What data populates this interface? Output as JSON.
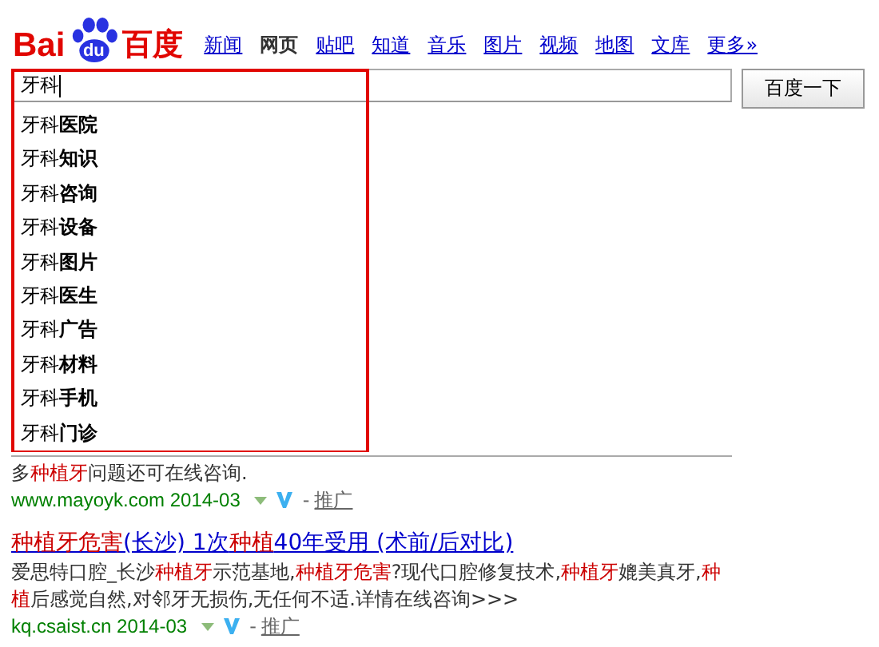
{
  "logo": {
    "left": "Bai",
    "mark": "du",
    "right": "百度"
  },
  "nav": [
    {
      "label": "新闻",
      "selected": false
    },
    {
      "label": "网页",
      "selected": true
    },
    {
      "label": "贴吧",
      "selected": false
    },
    {
      "label": "知道",
      "selected": false
    },
    {
      "label": "音乐",
      "selected": false
    },
    {
      "label": "图片",
      "selected": false
    },
    {
      "label": "视频",
      "selected": false
    },
    {
      "label": "地图",
      "selected": false
    },
    {
      "label": "文库",
      "selected": false
    },
    {
      "label": "更多»",
      "selected": false
    }
  ],
  "search": {
    "value": "牙科",
    "button": "百度一下"
  },
  "suggestions": [
    {
      "prefix": "牙科",
      "rest": "医院"
    },
    {
      "prefix": "牙科",
      "rest": "知识"
    },
    {
      "prefix": "牙科",
      "rest": "咨询"
    },
    {
      "prefix": "牙科",
      "rest": "设备"
    },
    {
      "prefix": "牙科",
      "rest": "图片"
    },
    {
      "prefix": "牙科",
      "rest": "医生"
    },
    {
      "prefix": "牙科",
      "rest": "广告"
    },
    {
      "prefix": "牙科",
      "rest": "材料"
    },
    {
      "prefix": "牙科",
      "rest": "手机"
    },
    {
      "prefix": "牙科",
      "rest": "门诊"
    }
  ],
  "results": [
    {
      "snippet": [
        {
          "text": "多",
          "highlight": false
        },
        {
          "text": "种植牙",
          "highlight": true
        },
        {
          "text": "问题还可在线咨询.",
          "highlight": false
        }
      ],
      "url": "www.mayoyk.com",
      "date": "2014-03",
      "separator": "-",
      "promo": "推广"
    },
    {
      "title": [
        {
          "text": "种植牙危害",
          "highlight": true
        },
        {
          "text": "(长沙)  1次",
          "highlight": false
        },
        {
          "text": "种植",
          "highlight": true
        },
        {
          "text": "40年受用  (术前/后对比)",
          "highlight": false
        }
      ],
      "snippet": [
        {
          "text": "爱思特口腔_长沙",
          "highlight": false
        },
        {
          "text": "种植牙",
          "highlight": true
        },
        {
          "text": "示范基地,",
          "highlight": false
        },
        {
          "text": "种植牙危害",
          "highlight": true
        },
        {
          "text": "?现代口腔修复技术,",
          "highlight": false
        },
        {
          "text": "种植牙",
          "highlight": true
        },
        {
          "text": "媲美真牙,",
          "highlight": false
        },
        {
          "text": "种植",
          "highlight": true
        },
        {
          "text": "后感觉自然,对邻牙无损伤,无任何不适.详情在线咨询>>>",
          "highlight": false
        }
      ],
      "url": "kq.csaist.cn",
      "date": "2014-03",
      "separator": "-",
      "promo": "推广"
    }
  ]
}
